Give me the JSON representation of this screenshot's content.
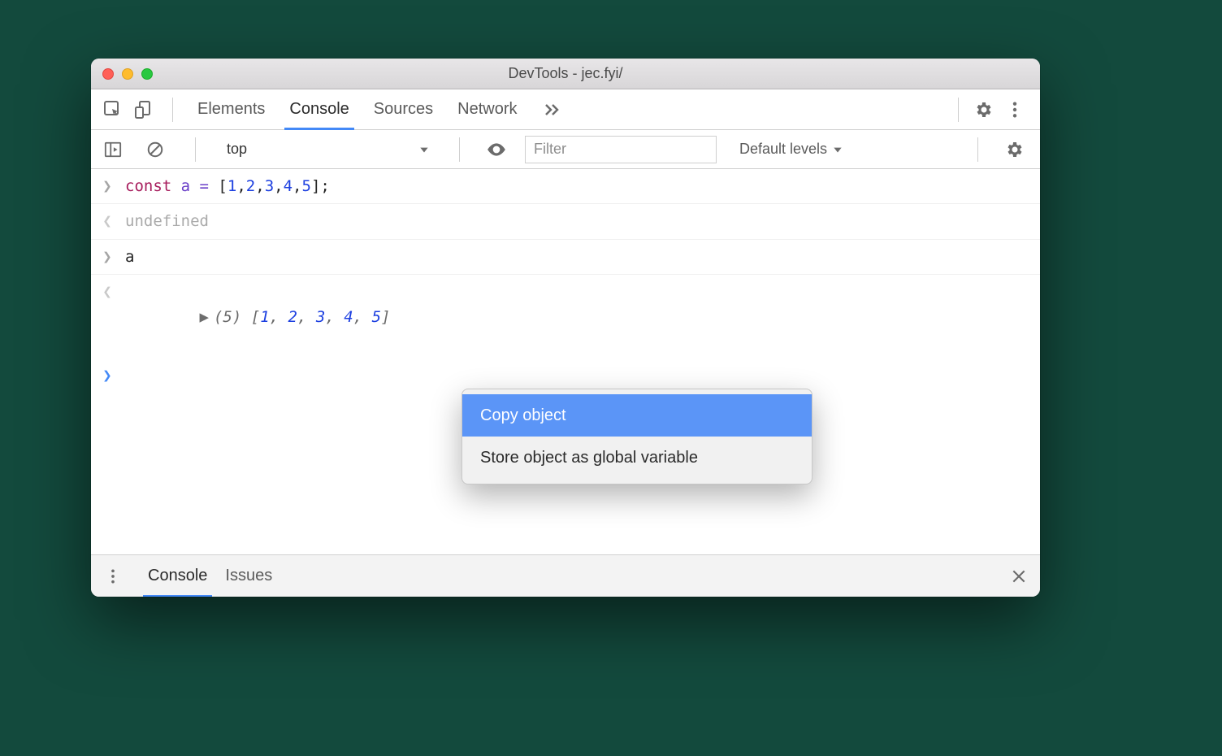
{
  "window": {
    "title": "DevTools - jec.fyi/"
  },
  "tabs": {
    "elements": "Elements",
    "console": "Console",
    "sources": "Sources",
    "network": "Network"
  },
  "subbar": {
    "context": "top",
    "filter_placeholder": "Filter",
    "levels_label": "Default levels"
  },
  "console": {
    "line1_kw": "const",
    "line1_id": " a",
    "line1_eq": " = ",
    "line1_br_open": "[",
    "line1_nums": [
      "1",
      "2",
      "3",
      "4",
      "5"
    ],
    "line1_br_close": "]",
    "line1_semicolon": ";",
    "line2": "undefined",
    "line3": "a",
    "line4_len": "(5)",
    "line4_open": " [",
    "line4_vals": [
      "1",
      "2",
      "3",
      "4",
      "5"
    ],
    "line4_close": "]"
  },
  "context_menu": {
    "copy": "Copy object",
    "store": "Store object as global variable"
  },
  "drawer": {
    "console": "Console",
    "issues": "Issues"
  }
}
